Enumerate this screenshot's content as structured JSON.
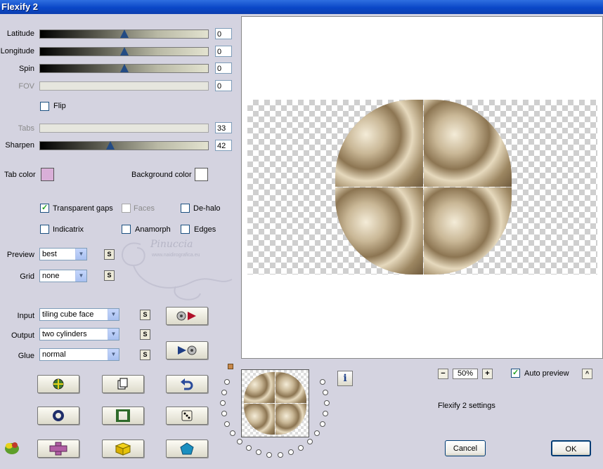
{
  "window": {
    "title": "Flexify 2"
  },
  "sliders": {
    "latitude": {
      "label": "Latitude",
      "value": "0",
      "fraction": 0.5
    },
    "longitude": {
      "label": "Longitude",
      "value": "0",
      "fraction": 0.5
    },
    "spin": {
      "label": "Spin",
      "value": "0",
      "fraction": 0.5
    },
    "fov": {
      "label": "FOV",
      "value": "0"
    },
    "tabs": {
      "label": "Tabs",
      "value": "33"
    },
    "sharpen": {
      "label": "Sharpen",
      "value": "42",
      "fraction": 0.42
    }
  },
  "flip": {
    "label": "Flip",
    "checked": false
  },
  "colors": {
    "tab_label": "Tab color",
    "tab_value": "#d9afd8",
    "background_label": "Background color",
    "background_value": "#ffffff"
  },
  "options": {
    "transparent_gaps": {
      "label": "Transparent gaps",
      "checked": true
    },
    "faces": {
      "label": "Faces",
      "checked": false
    },
    "de_halo": {
      "label": "De-halo",
      "checked": false
    },
    "indicatrix": {
      "label": "Indicatrix",
      "checked": false
    },
    "anamorph": {
      "label": "Anamorph",
      "checked": false
    },
    "edges": {
      "label": "Edges",
      "checked": false
    }
  },
  "selects": {
    "preview": {
      "label": "Preview",
      "value": "best"
    },
    "grid": {
      "label": "Grid",
      "value": "none"
    },
    "input": {
      "label": "Input",
      "value": "tiling cube face"
    },
    "output": {
      "label": "Output",
      "value": "two cylinders"
    },
    "glue": {
      "label": "Glue",
      "value": "normal"
    }
  },
  "s_button": "S",
  "zoom": {
    "minus": "−",
    "value": "50%",
    "plus": "+"
  },
  "auto_preview": {
    "label": "Auto preview",
    "checked": true
  },
  "caret": "^",
  "settings_label": "Flexify 2 settings",
  "info": "i",
  "buttons": {
    "cancel": "Cancel",
    "ok": "OK"
  },
  "watermark": {
    "name": "Pinuccia",
    "site": "www.naidirografica.eu"
  }
}
